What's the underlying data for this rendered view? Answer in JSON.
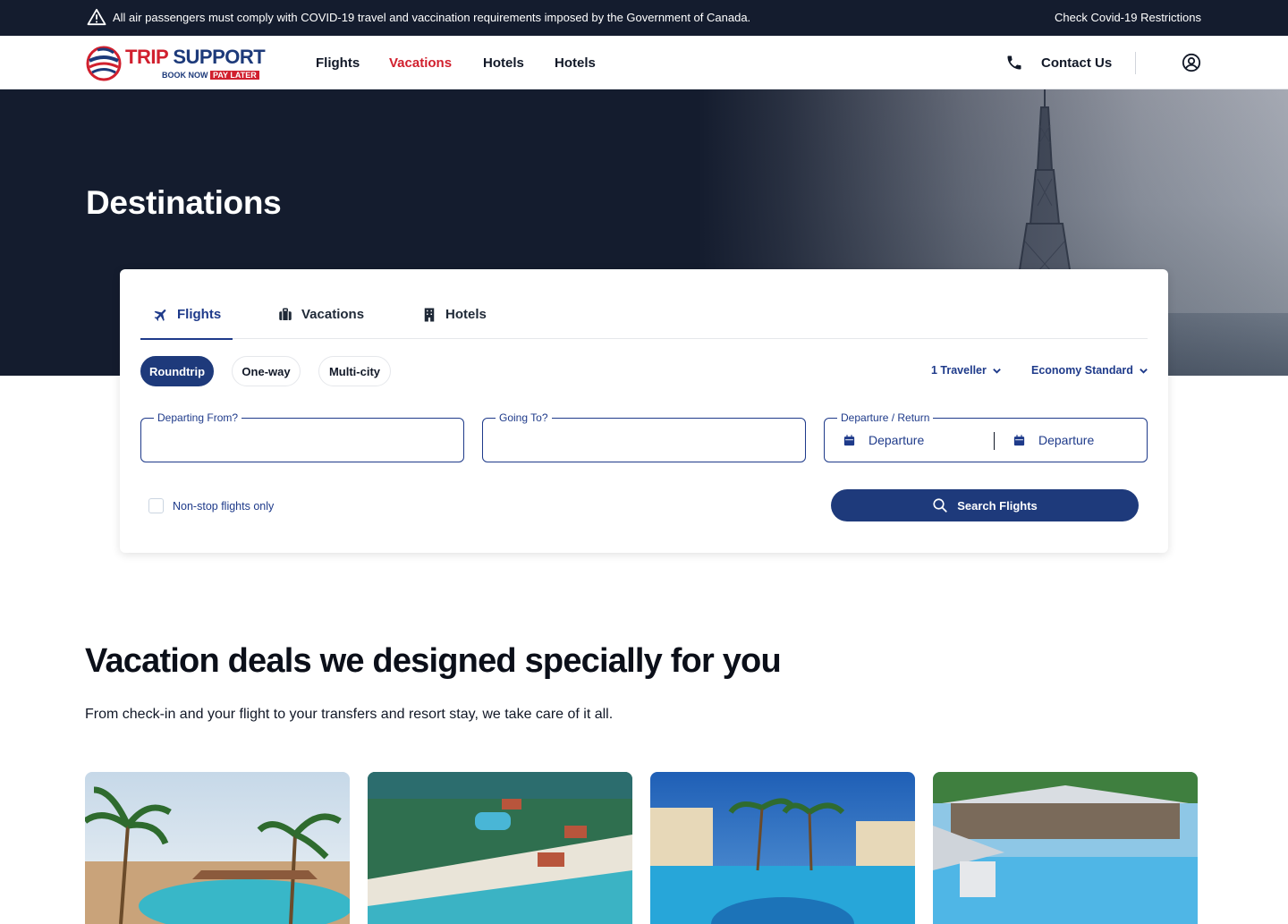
{
  "alert": {
    "message": "All air passengers must comply with COVID-19 travel and vaccination requirements imposed by the Government of Canada.",
    "link": "Check Covid-19 Restrictions"
  },
  "logo": {
    "trip": "TRIP",
    "support": "SUPPORT",
    "book_now": "BOOK NOW",
    "pay_later": "PAY LATER"
  },
  "nav": {
    "items": [
      {
        "label": "Flights"
      },
      {
        "label": "Vacations"
      },
      {
        "label": "Hotels"
      },
      {
        "label": "Hotels"
      }
    ],
    "active": "Vacations",
    "contact": "Contact Us"
  },
  "hero": {
    "title": "Destinations"
  },
  "search": {
    "tabs": [
      {
        "label": "Flights",
        "icon": "airplane-icon"
      },
      {
        "label": "Vacations",
        "icon": "suitcase-icon"
      },
      {
        "label": "Hotels",
        "icon": "hotel-building-icon"
      }
    ],
    "active_tab": "Flights",
    "trip_types": [
      {
        "label": "Roundtrip"
      },
      {
        "label": "One-way"
      },
      {
        "label": "Multi-city"
      }
    ],
    "active_trip_type": "Roundtrip",
    "travellers": "1 Traveller",
    "cabin": "Economy Standard",
    "fields": {
      "from_label": "Departing From?",
      "from_value": "",
      "to_label": "Going To?",
      "to_value": "",
      "dates_label": "Departure / Return",
      "departure": "Departure",
      "return": "Departure"
    },
    "nonstop_label": "Non-stop flights only",
    "nonstop_checked": false,
    "button": "Search Flights"
  },
  "deals": {
    "title": "Vacation deals we designed specially for you",
    "subtitle": "From check-in and your flight to your transfers and resort stay, we take care of it all."
  },
  "colors": {
    "navy": "#141c2e",
    "brand_red": "#d1202e",
    "brand_blue": "#1e3a7b"
  }
}
